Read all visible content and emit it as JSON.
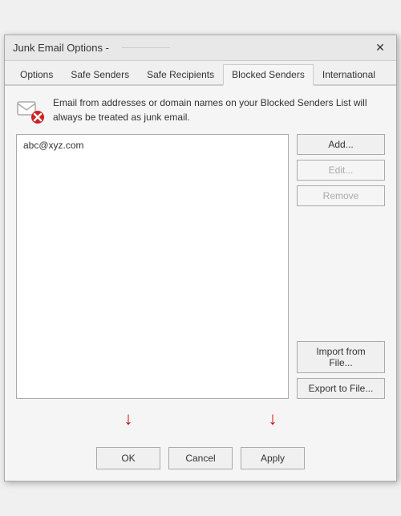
{
  "titleBar": {
    "title": "Junk Email Options -",
    "closeLabel": "✕"
  },
  "tabs": [
    {
      "id": "options",
      "label": "Options"
    },
    {
      "id": "safe-senders",
      "label": "Safe Senders"
    },
    {
      "id": "safe-recipients",
      "label": "Safe Recipients"
    },
    {
      "id": "blocked-senders",
      "label": "Blocked Senders",
      "active": true
    },
    {
      "id": "international",
      "label": "International"
    }
  ],
  "infoText": "Email from addresses or domain names on your Blocked Senders List will always be treated as junk email.",
  "listItems": [
    "abc@xyz.com"
  ],
  "sideButtons": {
    "add": "Add...",
    "edit": "Edit...",
    "remove": "Remove",
    "importFromFile": "Import from File...",
    "exportToFile": "Export to File..."
  },
  "bottomButtons": {
    "ok": "OK",
    "cancel": "Cancel",
    "apply": "Apply"
  },
  "arrows": {
    "ok": "↓",
    "apply": "↓"
  }
}
